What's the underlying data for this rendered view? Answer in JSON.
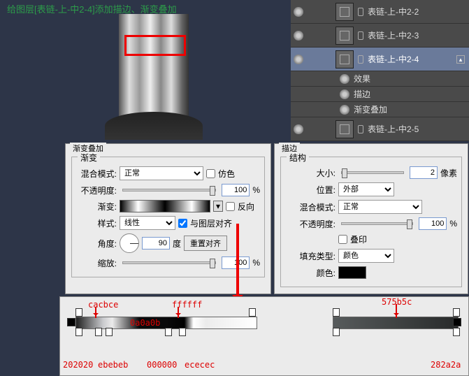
{
  "title": "给图层[表链-上-中2-4]添加描边、渐变叠加",
  "layers": [
    {
      "name": "表链-上-中2-2"
    },
    {
      "name": "表链-上-中2-3"
    },
    {
      "name": "表链-上-中2-4",
      "selected": true
    },
    {
      "name": "表链-上-中2-5"
    }
  ],
  "fx": {
    "header": "效果",
    "stroke": "描边",
    "gradient": "渐变叠加"
  },
  "go": {
    "panel": "渐变叠加",
    "section": "渐变",
    "blend_lbl": "混合模式:",
    "blend_val": "正常",
    "dither_lbl": "仿色",
    "opacity_lbl": "不透明度:",
    "opacity_val": "100",
    "pct": "%",
    "grad_lbl": "渐变:",
    "reverse_lbl": "反向",
    "style_lbl": "样式:",
    "style_val": "线性",
    "align_lbl": "与图层对齐",
    "angle_lbl": "角度:",
    "angle_val": "90",
    "deg": "度",
    "reset_btn": "重置对齐",
    "scale_lbl": "缩放:",
    "scale_val": "100"
  },
  "st": {
    "panel": "描边",
    "section": "结构",
    "size_lbl": "大小:",
    "size_val": "2",
    "px": "像素",
    "pos_lbl": "位置:",
    "pos_val": "外部",
    "blend_lbl": "混合模式:",
    "blend_val": "正常",
    "opacity_lbl": "不透明度:",
    "opacity_val": "100",
    "pct": "%",
    "overprint_lbl": "叠印",
    "fill_lbl": "填充类型:",
    "fill_val": "颜色",
    "color_lbl": "颜色:"
  },
  "stops": {
    "a": "cacbce",
    "b": "ffffff",
    "c": "0a0a0b",
    "d": "575b5c",
    "e": "202020",
    "f": "ebebeb",
    "g": "000000",
    "h": "ececec",
    "i": "282a2a"
  }
}
